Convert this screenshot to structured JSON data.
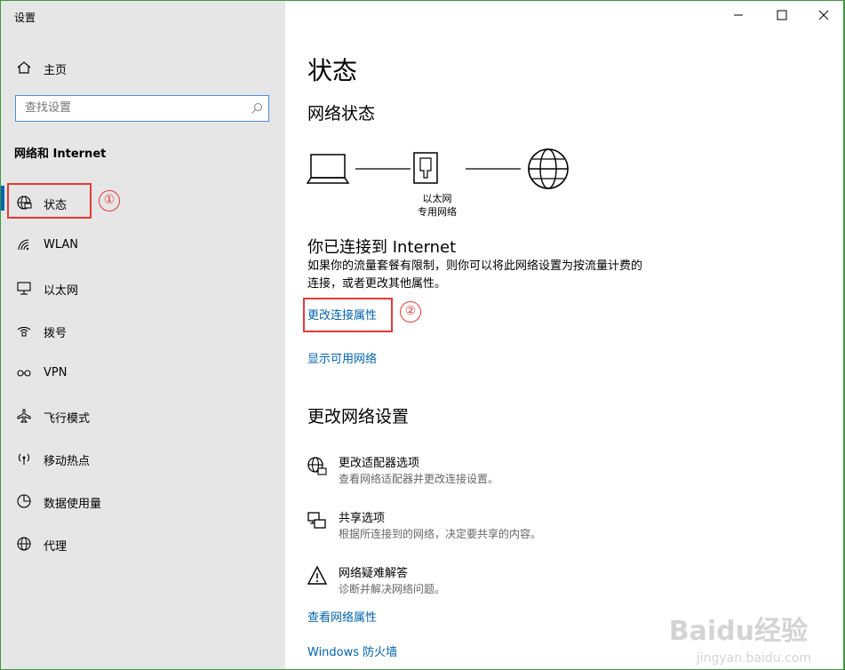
{
  "window": {
    "title": "设置"
  },
  "sidebar": {
    "home_label": "主页",
    "search_placeholder": "查找设置",
    "section_label": "网络和 Internet",
    "items": [
      {
        "label": "状态",
        "icon": "globe-status-icon"
      },
      {
        "label": "WLAN",
        "icon": "wifi-icon"
      },
      {
        "label": "以太网",
        "icon": "ethernet-icon"
      },
      {
        "label": "拨号",
        "icon": "dialup-icon"
      },
      {
        "label": "VPN",
        "icon": "vpn-icon"
      },
      {
        "label": "飞行模式",
        "icon": "airplane-icon"
      },
      {
        "label": "移动热点",
        "icon": "hotspot-icon"
      },
      {
        "label": "数据使用量",
        "icon": "data-usage-icon"
      },
      {
        "label": "代理",
        "icon": "globe-icon"
      }
    ],
    "active_item": "状态"
  },
  "main": {
    "page_title": "状态",
    "network_status_heading": "网络状态",
    "adapter_label_line1": "以太网",
    "adapter_label_line2": "专用网络",
    "connected_heading": "你已连接到 Internet",
    "connected_desc_line1": "如果你的流量套餐有限制，则你可以将此网络设置为按流量计费的",
    "connected_desc_line2": "连接，或者更改其他属性。",
    "change_connection_link": "更改连接属性",
    "show_networks_link": "显示可用网络",
    "change_settings_heading": "更改网络设置",
    "options": [
      {
        "title": "更改适配器选项",
        "desc": "查看网络适配器并更改连接设置。",
        "icon": "adapter-icon"
      },
      {
        "title": "共享选项",
        "desc": "根据所连接到的网络，决定要共享的内容。",
        "icon": "sharing-icon"
      },
      {
        "title": "网络疑难解答",
        "desc": "诊断并解决网络问题。",
        "icon": "warning-icon"
      }
    ],
    "view_properties_link": "查看网络属性",
    "firewall_link": "Windows 防火墙"
  },
  "annotations": {
    "marker1": "①",
    "marker2": "②"
  },
  "watermark": {
    "brand": "Baidu经验",
    "url": "jingyan.baidu.com"
  },
  "colors": {
    "accent": "#0063b1",
    "sidebar_bg": "#e6e6e6",
    "annotation": "#e53935"
  }
}
